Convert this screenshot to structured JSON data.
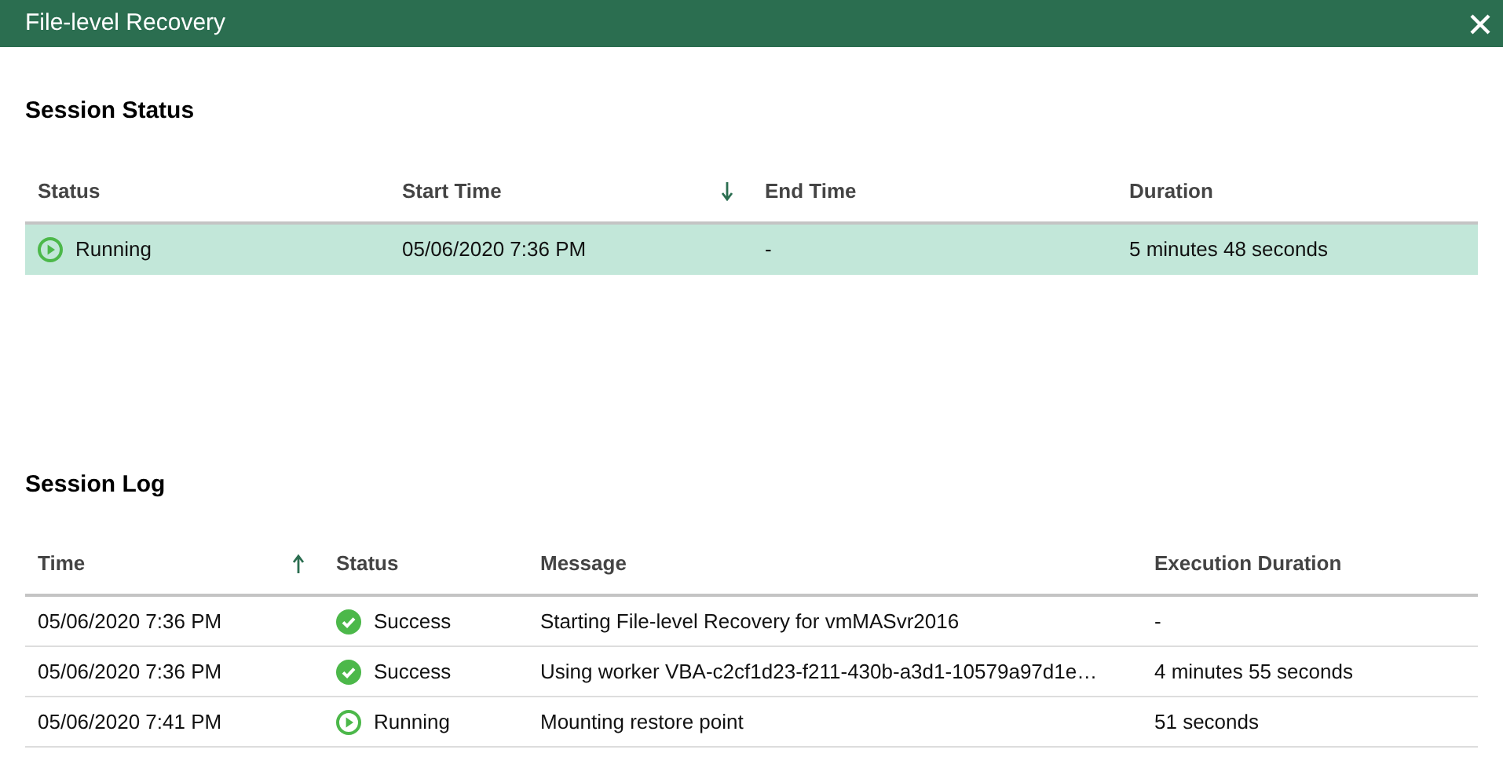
{
  "window": {
    "title": "File-level Recovery"
  },
  "session_status": {
    "heading": "Session Status",
    "columns": [
      {
        "label": "Status",
        "sorted": false
      },
      {
        "label": "Start Time",
        "sorted": true,
        "ascending": false
      },
      {
        "label": "End Time",
        "sorted": false
      },
      {
        "label": "Duration",
        "sorted": false
      }
    ],
    "rows": [
      {
        "selected": true,
        "cells": [
          {
            "kind": "running",
            "text": "Running"
          },
          {
            "kind": "text",
            "text": "05/06/2020 7:36 PM"
          },
          {
            "kind": "text",
            "text": "-"
          },
          {
            "kind": "text",
            "text": "5 minutes 48 seconds"
          }
        ]
      }
    ]
  },
  "session_log": {
    "heading": "Session Log",
    "columns": [
      {
        "label": "Time",
        "sorted": true,
        "ascending": true
      },
      {
        "label": "Status",
        "sorted": false
      },
      {
        "label": "Message",
        "sorted": false
      },
      {
        "label": "Execution Duration",
        "sorted": false
      }
    ],
    "rows": [
      {
        "selected": false,
        "cells": [
          {
            "kind": "text",
            "text": "05/06/2020 7:36 PM"
          },
          {
            "kind": "success",
            "text": "Success"
          },
          {
            "kind": "text",
            "text": "Starting File-level Recovery for vmMASvr2016"
          },
          {
            "kind": "text",
            "text": "-"
          }
        ]
      },
      {
        "selected": false,
        "cells": [
          {
            "kind": "text",
            "text": "05/06/2020 7:36 PM"
          },
          {
            "kind": "success",
            "text": "Success"
          },
          {
            "kind": "text",
            "text": "Using worker VBA-c2cf1d23-f211-430b-a3d1-10579a97d1e…"
          },
          {
            "kind": "text",
            "text": "4 minutes 55 seconds"
          }
        ]
      },
      {
        "selected": false,
        "cells": [
          {
            "kind": "text",
            "text": "05/06/2020 7:41 PM"
          },
          {
            "kind": "running",
            "text": "Running"
          },
          {
            "kind": "text",
            "text": "Mounting restore point"
          },
          {
            "kind": "text",
            "text": "51 seconds"
          }
        ]
      }
    ]
  }
}
